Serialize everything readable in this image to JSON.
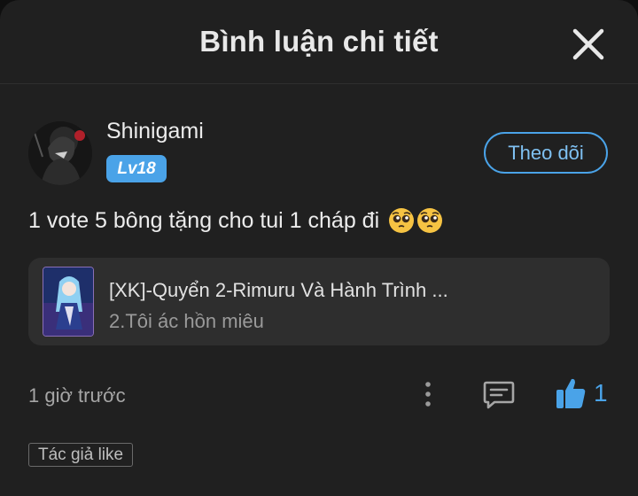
{
  "header": {
    "title": "Bình luận chi tiết",
    "close_icon": "close-icon"
  },
  "comment": {
    "user": {
      "name": "Shinigami",
      "level": "Lv18",
      "avatar_icon": "avatar"
    },
    "follow_label": "Theo dõi",
    "text": "1 vote 5 bông tặng cho tui 1 cháp đi",
    "emojis": [
      "pleading-face",
      "pleading-face"
    ],
    "novel": {
      "title": "[XK]-Quyển 2-Rimuru Và Hành Trình ...",
      "chapter": "2.Tôi ác hồn miêu"
    },
    "time": "1 giờ trước",
    "likes": "1",
    "tag": "Tác giả like"
  },
  "colors": {
    "accent": "#4aa3e8",
    "background": "#202020",
    "card": "#2e2e2e"
  }
}
